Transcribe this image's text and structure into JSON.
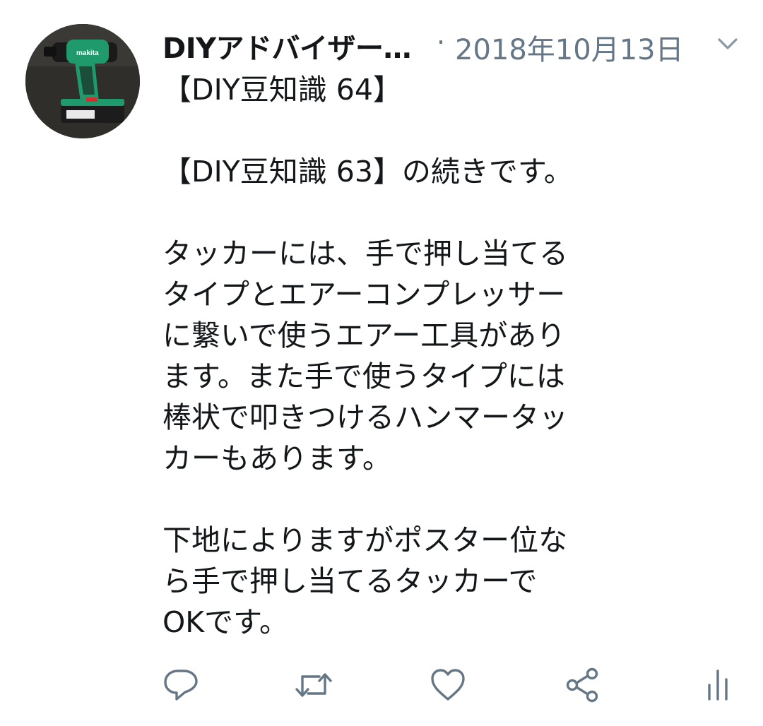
{
  "author": {
    "display_name": "DIYアドバイザー…",
    "avatar_label": "makita"
  },
  "separator": "·",
  "timestamp": "2018年10月13日",
  "body_lines": [
    "【DIY豆知識 64】",
    "",
    "【DIY豆知識 63】の続きです。",
    "",
    "タッカーには、手で押し当てる",
    "タイプとエアーコンプレッサー",
    "に繋いで使うエアー工具があり",
    "ます。また手で使うタイプには",
    "棒状で叩きつけるハンマータッ",
    "カーもあります。",
    "",
    "下地によりますがポスター位な",
    "ら手で押し当てるタッカーで",
    "OKです。"
  ],
  "actions": [
    {
      "name": "reply",
      "icon": "reply-icon"
    },
    {
      "name": "retweet",
      "icon": "retweet-icon"
    },
    {
      "name": "like",
      "icon": "heart-icon"
    },
    {
      "name": "share",
      "icon": "share-icon"
    },
    {
      "name": "analytics",
      "icon": "analytics-icon"
    }
  ],
  "colors": {
    "text": "#14171a",
    "secondary": "#657786",
    "icon": "#657786",
    "avatar_bg": "#2b2a27",
    "drill_green": "#1f9a6d"
  }
}
